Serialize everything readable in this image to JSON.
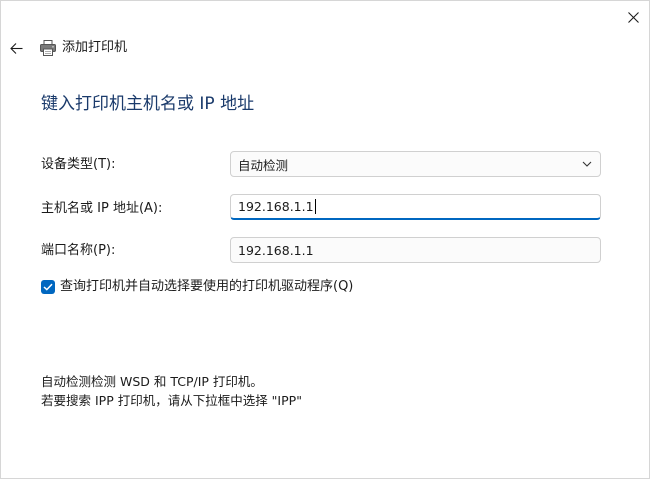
{
  "window": {
    "title": "添加打印机"
  },
  "heading": "键入打印机主机名或 IP 地址",
  "fields": {
    "device_type": {
      "label": "设备类型(T):",
      "value": "自动检测"
    },
    "hostname": {
      "label": "主机名或 IP 地址(A):",
      "value": "192.168.1.1"
    },
    "port_name": {
      "label": "端口名称(P):",
      "value": "192.168.1.1"
    }
  },
  "checkbox": {
    "label": "查询打印机并自动选择要使用的打印机驱动程序(Q)",
    "checked": true
  },
  "info": {
    "line1": "自动检测检测 WSD 和 TCP/IP 打印机。",
    "line2": "若要搜索 IPP 打印机，请从下拉框中选择 \"IPP\""
  },
  "icons": {
    "close": "close-icon",
    "back": "back-arrow-icon",
    "printer": "printer-icon",
    "chevron": "chevron-down-icon",
    "check": "checkmark-icon"
  },
  "colors": {
    "accent": "#0067c0",
    "heading": "#1a3a6b"
  }
}
